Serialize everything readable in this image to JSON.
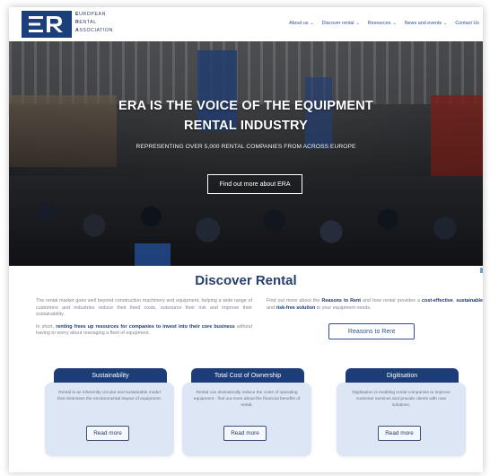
{
  "brand": {
    "logo_initials": "ER",
    "name_lines": [
      {
        "cap": "E",
        "rest": "UROPEAN"
      },
      {
        "cap": "R",
        "rest": "ENTAL"
      },
      {
        "cap": "A",
        "rest": "SSOCIATION"
      }
    ],
    "primary_color": "#1c3c7a"
  },
  "nav": {
    "items": [
      {
        "label": "About us",
        "icon": "chevron-down-icon",
        "has_dropdown": true
      },
      {
        "label": "Discover rental",
        "icon": "chevron-down-icon",
        "has_dropdown": true
      },
      {
        "label": "Resources",
        "icon": "chevron-down-icon",
        "has_dropdown": true
      },
      {
        "label": "News and events",
        "icon": "chevron-down-icon",
        "has_dropdown": true
      },
      {
        "label": "Contact Us",
        "has_dropdown": false
      }
    ],
    "chevron_glyph": "⌄"
  },
  "hero": {
    "title_line1": "ERA IS THE VOICE OF THE EQUIPMENT",
    "title_line2": "RENTAL INDUSTRY",
    "subtitle": "REPRESENTING OVER 5,000 RENTAL COMPANIES FROM ACROSS EUROPE",
    "cta_label": "Find out more about ERA"
  },
  "discover": {
    "title": "Discover Rental",
    "left_p1": "The rental market goes well beyond construction machinery and equipment, helping a wide range of customers and industries reduce their fixed costs, outsource their risk and improve their sustainability.",
    "left_p2_prefix": "In short, ",
    "left_p2_bold": "renting frees up resources for companies to invest into their core business",
    "left_p2_suffix": " without having to worry about managing a fleet of equipment.",
    "right_prefix": "Find out more about the ",
    "right_bold1": "Reasons to Rent",
    "right_mid1": " and how rental provides a ",
    "right_bold2": "cost-effective",
    "right_mid2": ", ",
    "right_bold3": "sustainable",
    "right_mid3": " and ",
    "right_bold4": "risk-free solution",
    "right_suffix": " to your equipment needs.",
    "reasons_button": "Reasons to Rent"
  },
  "cards": [
    {
      "title": "Sustainability",
      "text": "Rental is an inherently circular and sustainable model that minimises the environmental impact of equipment.",
      "button": "Read more"
    },
    {
      "title": "Total Cost of Ownership",
      "text": "Rental can dramatically reduce the costs of operating equipment - find out more about the financial benefits of rental.",
      "button": "Read more"
    },
    {
      "title": "Digitisation",
      "text": "Digitisation is enabling rental companies to improve customer services and provide clients with new solutions.",
      "button": "Read more"
    }
  ]
}
